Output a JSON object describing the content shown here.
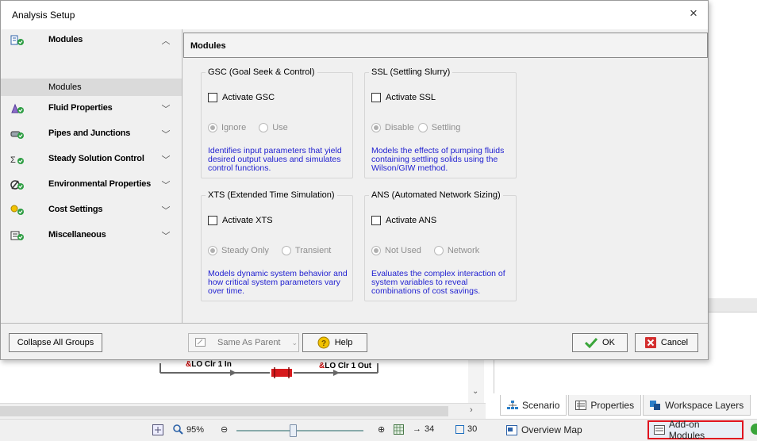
{
  "dialog": {
    "title": "Analysis Setup",
    "close_label": "×"
  },
  "sidebar": {
    "groups": [
      {
        "label": "Modules",
        "icon": "modules-icon",
        "chevron": "^"
      },
      {
        "label": "Fluid Properties",
        "icon": "fluid-properties-icon",
        "chevron": "v"
      },
      {
        "label": "Pipes and Junctions",
        "icon": "pipes-junctions-icon",
        "chevron": "v"
      },
      {
        "label": "Steady Solution Control",
        "icon": "steady-solution-icon",
        "chevron": "v"
      },
      {
        "label": "Environmental Properties",
        "icon": "environmental-properties-icon",
        "chevron": "v"
      },
      {
        "label": "Cost Settings",
        "icon": "cost-settings-icon",
        "chevron": "v"
      },
      {
        "label": "Miscellaneous",
        "icon": "miscellaneous-icon",
        "chevron": "v"
      }
    ],
    "selected_subitem": "Modules"
  },
  "panel": {
    "header": "Modules",
    "modules": [
      {
        "title": "GSC (Goal Seek & Control)",
        "checkbox": "Activate GSC",
        "options": [
          "Ignore",
          "Use"
        ],
        "selected": 0,
        "description": "Identifies input parameters that yield desired output values and simulates control functions."
      },
      {
        "title": "SSL (Settling Slurry)",
        "checkbox": "Activate SSL",
        "options": [
          "Disable",
          "Settling"
        ],
        "selected": 0,
        "description": "Models the effects of pumping fluids containing settling solids using the Wilson/GIW method."
      },
      {
        "title": "XTS (Extended Time Simulation)",
        "checkbox": "Activate XTS",
        "options": [
          "Steady Only",
          "Transient"
        ],
        "selected": 0,
        "description": "Models dynamic system behavior and how critical system parameters vary over time."
      },
      {
        "title": "ANS (Automated Network Sizing)",
        "checkbox": "Activate ANS",
        "options": [
          "Not Used",
          "Network"
        ],
        "selected": 0,
        "description": "Evaluates the complex interaction of system variables to reveal combinations of cost savings."
      }
    ]
  },
  "footer": {
    "collapse_label": "Collapse All Groups",
    "parent_combo": "Same As Parent",
    "help_label": "Help",
    "ok_label": "OK",
    "cancel_label": "Cancel"
  },
  "background": {
    "pipe_label_in_prefix": "&",
    "pipe_label_in": "LO Clr 1 In",
    "pipe_label_out_prefix": "&",
    "pipe_label_out": "LO Clr 1 Out",
    "zoom": "95%",
    "pipes_count": "34",
    "junctions_count": "30",
    "tabs": [
      "Scenario",
      "Properties",
      "Workspace Layers"
    ],
    "overview_map": "Overview Map",
    "addon_modules": "Add-on Modules"
  },
  "colors": {
    "description_text": "#1f1fd0",
    "ok_check": "#3aa53a",
    "cancel_red": "#d32f2f",
    "highlight_box": "#e0141e"
  }
}
